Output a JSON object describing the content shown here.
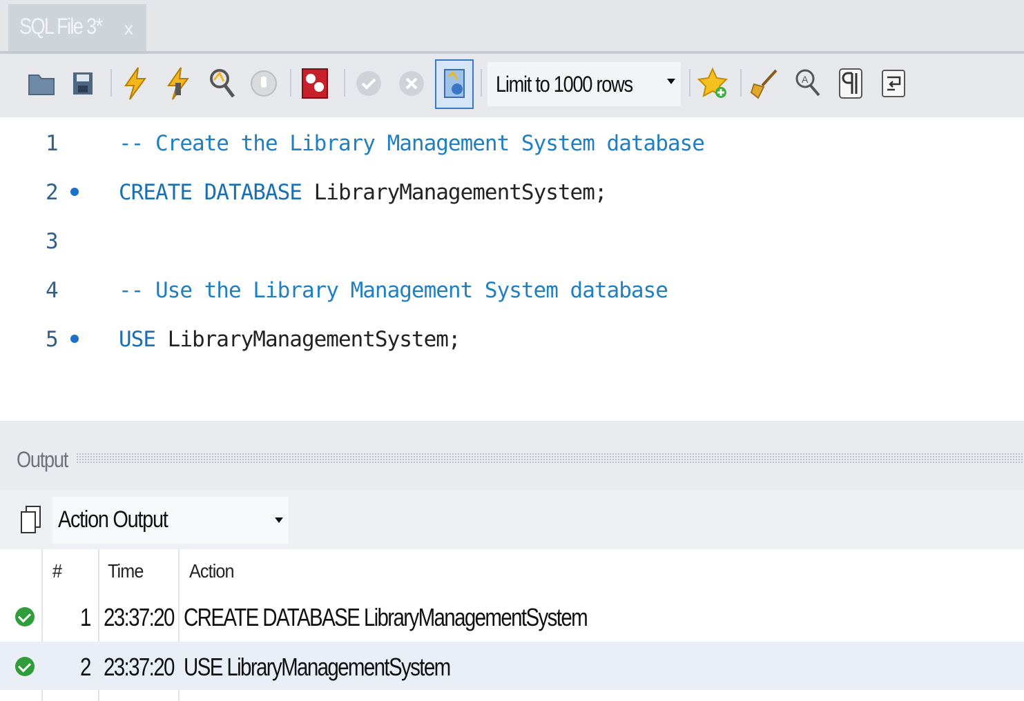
{
  "tab": {
    "title": "SQL File 3*",
    "close": "x"
  },
  "toolbar": {
    "buttons": [
      "open-file",
      "save",
      "execute",
      "execute-current",
      "explain",
      "stop",
      "toggle-error",
      "commit",
      "rollback",
      "autocommit"
    ],
    "limit": {
      "selected": "Limit to 1000 rows"
    }
  },
  "editor": {
    "lines": [
      {
        "num": "1",
        "parts": [
          {
            "t": "-- Create the Library Management System database",
            "c": "cmt"
          }
        ],
        "marker": false
      },
      {
        "num": "2",
        "parts": [
          {
            "t": "CREATE DATABASE ",
            "c": "kw"
          },
          {
            "t": "LibraryManagementSystem;",
            "c": "plain"
          }
        ],
        "marker": true
      },
      {
        "num": "3",
        "parts": [],
        "marker": false
      },
      {
        "num": "4",
        "parts": [
          {
            "t": "-- Use the Library Management System database",
            "c": "cmt"
          }
        ],
        "marker": false
      },
      {
        "num": "5",
        "parts": [
          {
            "t": "USE ",
            "c": "kw"
          },
          {
            "t": "LibraryManagementSystem;",
            "c": "plain"
          }
        ],
        "marker": true
      }
    ]
  },
  "output": {
    "label": "Output",
    "selector": "Action Output",
    "columns": {
      "num": "#",
      "time": "Time",
      "action": "Action"
    },
    "rows": [
      {
        "num": "1",
        "time": "23:37:20",
        "action": "CREATE DATABASE LibraryManagementSystem",
        "status": "ok"
      },
      {
        "num": "2",
        "time": "23:37:20",
        "action": "USE LibraryManagementSystem",
        "status": "ok"
      }
    ]
  }
}
